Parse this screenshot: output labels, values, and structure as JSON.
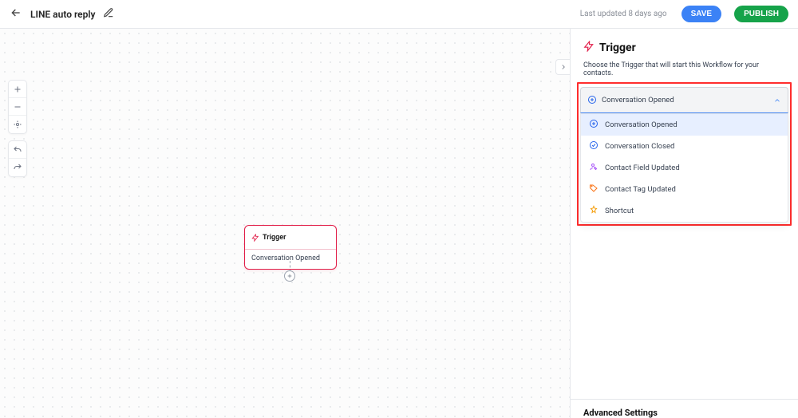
{
  "header": {
    "title": "LINE auto reply",
    "last_updated": "Last updated 8 days ago",
    "save_label": "SAVE",
    "publish_label": "PUBLISH"
  },
  "canvas": {
    "node": {
      "title": "Trigger",
      "body": "Conversation Opened"
    }
  },
  "panel": {
    "title": "Trigger",
    "description": "Choose the Trigger that will start this Workflow for your contacts.",
    "selected_label": "Conversation Opened",
    "options": {
      "0": {
        "label": "Conversation Opened"
      },
      "1": {
        "label": "Conversation Closed"
      },
      "2": {
        "label": "Contact Field Updated"
      },
      "3": {
        "label": "Contact Tag Updated"
      },
      "4": {
        "label": "Shortcut"
      }
    },
    "advanced_label": "Advanced Settings"
  }
}
